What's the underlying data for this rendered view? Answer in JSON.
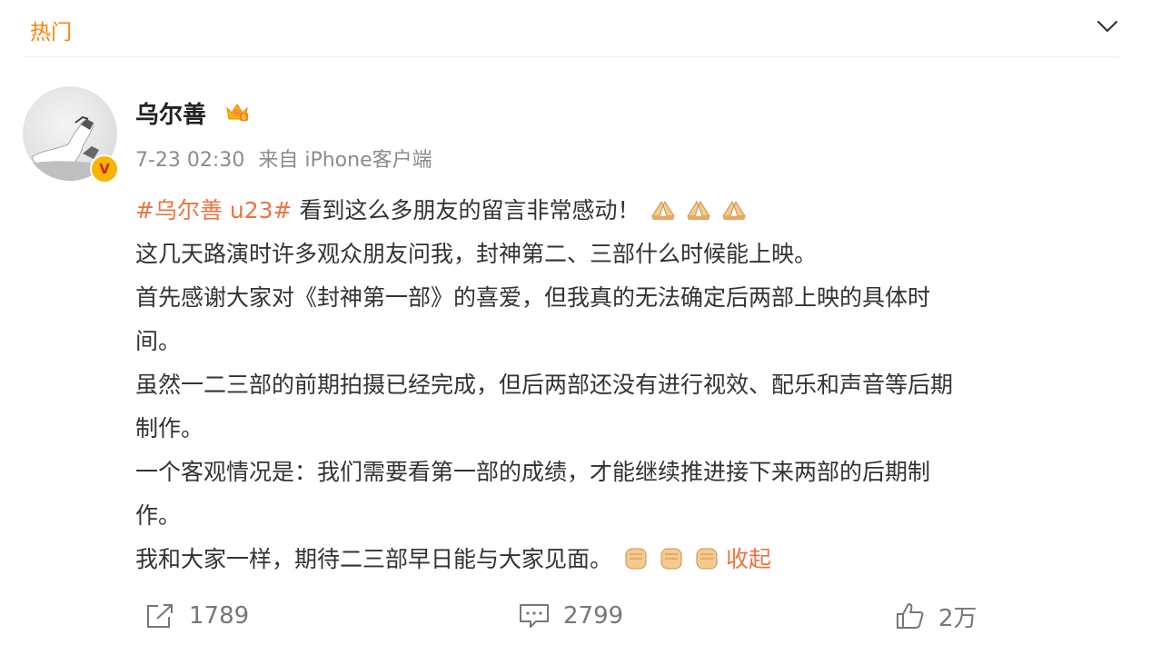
{
  "header": {
    "tab_label": "热门"
  },
  "post": {
    "username": "乌尔善",
    "verified_badge": "V",
    "time": "7-23 02:30",
    "source_prefix": "来自",
    "source": "iPhone客户端",
    "hashtag": "#乌尔善 u23#",
    "line1_text": " 看到这么多朋友的留言非常感动！",
    "line2": "这几天路演时许多观众朋友问我，封神第二、三部什么时候能上映。",
    "line3": "首先感谢大家对《封神第一部》的喜爱，但我真的无法确定后两部上映的具体时",
    "line4": "间。",
    "line5": "虽然一二三部的前期拍摄已经完成，但后两部还没有进行视效、配乐和声音等后期",
    "line6": "制作。",
    "line7": "一个客观情况是：我们需要看第一部的成绩，才能继续推进接下来两部的后期制",
    "line8": "作。",
    "line9": "我和大家一样，期待二三部早日能与大家见面。",
    "collapse_label": "收起",
    "emoji_line1": "pray-emoji",
    "emoji_line9": "fist-emoji"
  },
  "actions": {
    "repost_count": "1789",
    "comment_count": "2799",
    "like_count": "2万"
  },
  "colors": {
    "accent": "#ff8200",
    "link": "#eb7340",
    "meta": "#8b8b8b"
  }
}
